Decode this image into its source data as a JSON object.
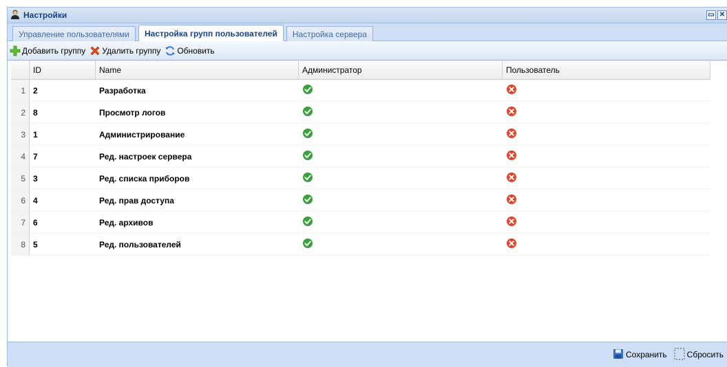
{
  "window": {
    "title": "Настройки",
    "icon": "user-icon"
  },
  "tabs": [
    {
      "label": "Управление пользователями",
      "active": false
    },
    {
      "label": "Настройка групп пользователей",
      "active": true
    },
    {
      "label": "Настройка сервера",
      "active": false
    }
  ],
  "toolbar": {
    "add_label": "Добавить группу",
    "delete_label": "Удалить группу",
    "refresh_label": "Обновить"
  },
  "table": {
    "columns": [
      "ID",
      "Name",
      "Администратор",
      "Пользователь"
    ],
    "rows": [
      {
        "num": "1",
        "id": "2",
        "name": "Разработка",
        "admin": true,
        "user": false
      },
      {
        "num": "2",
        "id": "8",
        "name": "Просмотр логов",
        "admin": true,
        "user": false
      },
      {
        "num": "3",
        "id": "1",
        "name": "Администрирование",
        "admin": true,
        "user": false
      },
      {
        "num": "4",
        "id": "7",
        "name": "Ред. настроек сервера",
        "admin": true,
        "user": false
      },
      {
        "num": "5",
        "id": "3",
        "name": "Ред. списка приборов",
        "admin": true,
        "user": false
      },
      {
        "num": "6",
        "id": "4",
        "name": "Ред. прав доступа",
        "admin": true,
        "user": false
      },
      {
        "num": "7",
        "id": "6",
        "name": "Ред. архивов",
        "admin": true,
        "user": false
      },
      {
        "num": "8",
        "id": "5",
        "name": "Ред. пользователей",
        "admin": true,
        "user": false
      }
    ]
  },
  "footer": {
    "save_label": "Сохранить",
    "reset_label": "Сбросить"
  },
  "colors": {
    "accent": "#15428b",
    "check": "#3aa23a",
    "cross": "#e0452b",
    "panel": "#cedff5"
  }
}
